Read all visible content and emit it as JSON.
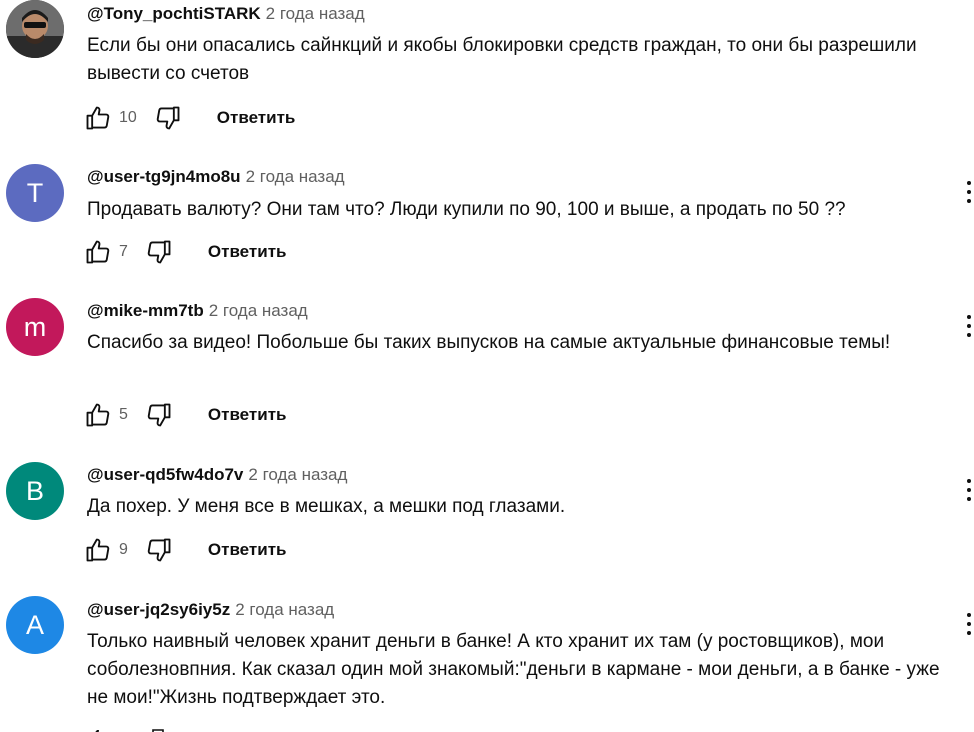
{
  "comments": [
    {
      "avatar_letter": "",
      "avatar_color": "#3a3a3a",
      "author": "@Tony_pochtiSTARK",
      "time": "2 года назад",
      "text": "Если бы они опасались сайнкций и якобы блокировки средств граждан, то они бы разрешили вывести со счетов",
      "likes": "10",
      "reply_label": "Ответить"
    },
    {
      "avatar_letter": "T",
      "avatar_color": "#5c6bc0",
      "author": "@user-tg9jn4mo8u",
      "time": "2 года назад",
      "text": "Продавать валюту? Они там что? Люди купили по 90, 100 и выше, а продать по 50 ??",
      "likes": "7",
      "reply_label": "Ответить"
    },
    {
      "avatar_letter": "m",
      "avatar_color": "#c2185b",
      "author": "@mike-mm7tb",
      "time": "2 года назад",
      "text": "Спасибо за видео! Побольше бы таких выпусков на самые актуальные финансовые темы!",
      "likes": "5",
      "reply_label": "Ответить"
    },
    {
      "avatar_letter": "B",
      "avatar_color": "#00897b",
      "author": "@user-qd5fw4do7v",
      "time": "2 года назад",
      "text": "Да похер. У меня все в мешках, а мешки под глазами.",
      "likes": "9",
      "reply_label": "Ответить"
    },
    {
      "avatar_letter": "A",
      "avatar_color": "#1e88e5",
      "author": "@user-jq2sy6iy5z",
      "time": "2 года назад",
      "text": "Только наивный человек хранит деньги в банке! А кто хранит их там (у ростовщиков), мои соболезновпния. Как сказал один мой знакомый:\"деньги в кармане - мои деньги, а в банке - уже не мои!\"Жизнь подтверждает это.",
      "likes": "",
      "reply_label": ""
    }
  ]
}
